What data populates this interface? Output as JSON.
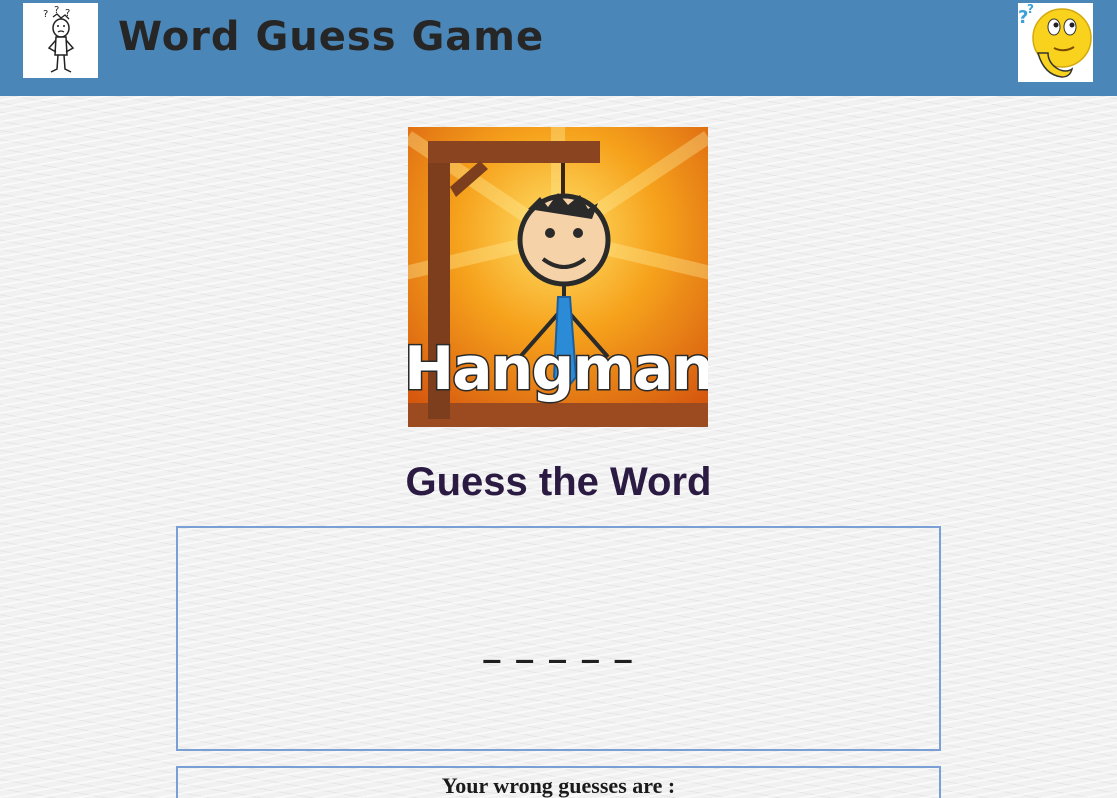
{
  "header": {
    "title": "Word Guess Game",
    "left_icon": "confused-stickman-icon",
    "right_icon": "thinking-emoji-icon",
    "background": "#4a86b7"
  },
  "main": {
    "hero_image": {
      "icon": "hangman-logo",
      "text": "Hangman"
    },
    "heading": "Guess the Word",
    "word_display": "_ _ _ _ _",
    "wrong_guesses_label": "Your wrong guesses are :"
  }
}
